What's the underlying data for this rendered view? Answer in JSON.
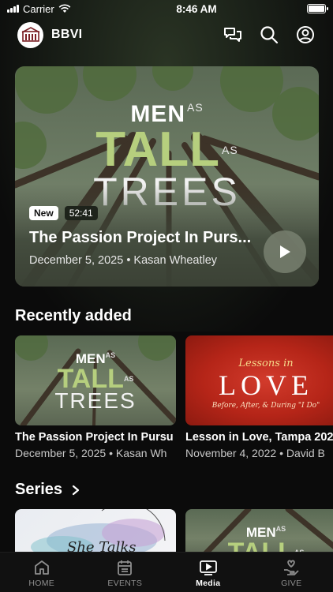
{
  "status_bar": {
    "carrier": "Carrier",
    "time": "8:46 AM",
    "battery_percent": 100
  },
  "header": {
    "app_name": "BBVI"
  },
  "hero": {
    "art": {
      "line1": "MEN",
      "small1": "AS",
      "line2": "TALL",
      "small2": "AS",
      "line3": "TREES"
    },
    "badge_new": "New",
    "duration": "52:41",
    "title": "The Passion Project In Purs...",
    "meta": "December 5, 2025 • Kasan Wheatley"
  },
  "recent": {
    "title": "Recently added",
    "items": [
      {
        "title": "The Passion Project In Pursu",
        "meta": "December 5, 2025 • Kasan Wh",
        "art": {
          "line1": "MEN",
          "small1": "AS",
          "line2": "TALL",
          "small2": "AS",
          "line3": "TREES"
        }
      },
      {
        "title": "Lesson in Love, Tampa 202",
        "meta": "November 4, 2022 • David B",
        "art": {
          "top": "Lessons in",
          "big": "LOVE",
          "sub": "Before, After, & During \"I Do\""
        }
      }
    ]
  },
  "series": {
    "title": "Series",
    "items": [
      {
        "art_text": "She Talks"
      },
      {
        "art": {
          "line1": "MEN",
          "small1": "AS",
          "line2": "TALL",
          "small2": "AS"
        }
      }
    ]
  },
  "tabs": [
    {
      "label": "HOME",
      "icon": "home-icon"
    },
    {
      "label": "EVENTS",
      "icon": "calendar-icon"
    },
    {
      "label": "Media",
      "icon": "media-icon",
      "active": true
    },
    {
      "label": "GIVE",
      "icon": "give-icon"
    }
  ]
}
